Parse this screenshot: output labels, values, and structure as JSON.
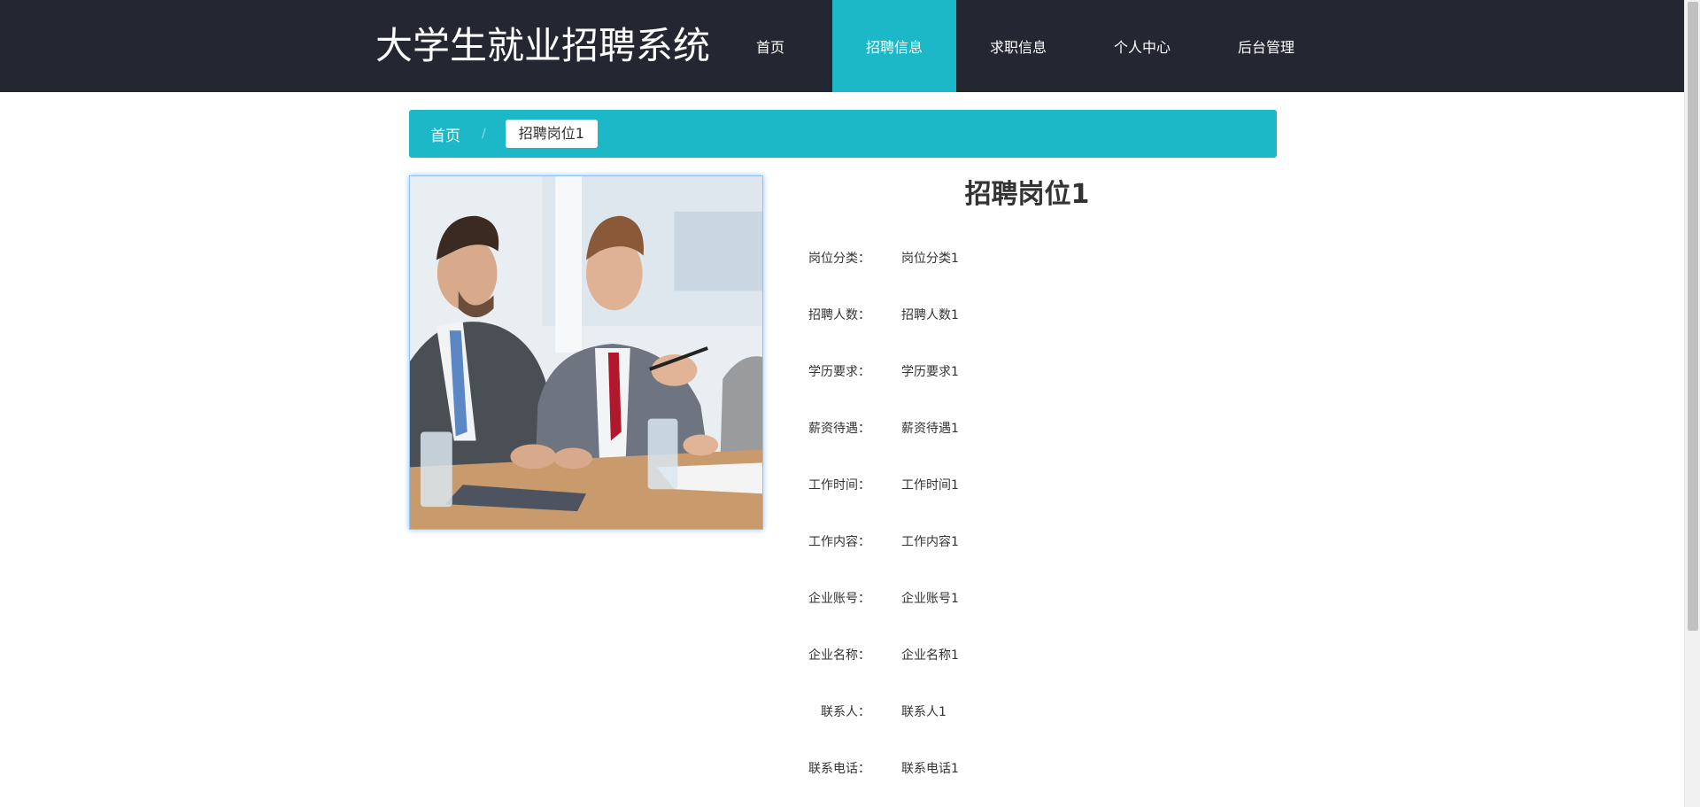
{
  "header": {
    "brand": "大学生就业招聘系统",
    "nav": [
      {
        "label": "首页",
        "active": false
      },
      {
        "label": "招聘信息",
        "active": true
      },
      {
        "label": "求职信息",
        "active": false
      },
      {
        "label": "个人中心",
        "active": false
      },
      {
        "label": "后台管理",
        "active": false
      }
    ]
  },
  "breadcrumb": {
    "home": "首页",
    "separator": "/",
    "current": "招聘岗位1"
  },
  "job": {
    "title": "招聘岗位1",
    "fields": [
      {
        "label": "岗位分类：",
        "value": "岗位分类1"
      },
      {
        "label": "招聘人数：",
        "value": "招聘人数1"
      },
      {
        "label": "学历要求：",
        "value": "学历要求1"
      },
      {
        "label": "薪资待遇：",
        "value": "薪资待遇1"
      },
      {
        "label": "工作时间：",
        "value": "工作时间1"
      },
      {
        "label": "工作内容：",
        "value": "工作内容1"
      },
      {
        "label": "企业账号：",
        "value": "企业账号1"
      },
      {
        "label": "企业名称：",
        "value": "企业名称1"
      },
      {
        "label": "联系人：",
        "value": "联系人1"
      },
      {
        "label": "联系电话：",
        "value": "联系电话1"
      }
    ]
  },
  "colors": {
    "header_bg": "#242632",
    "accent": "#1cb8c8"
  }
}
